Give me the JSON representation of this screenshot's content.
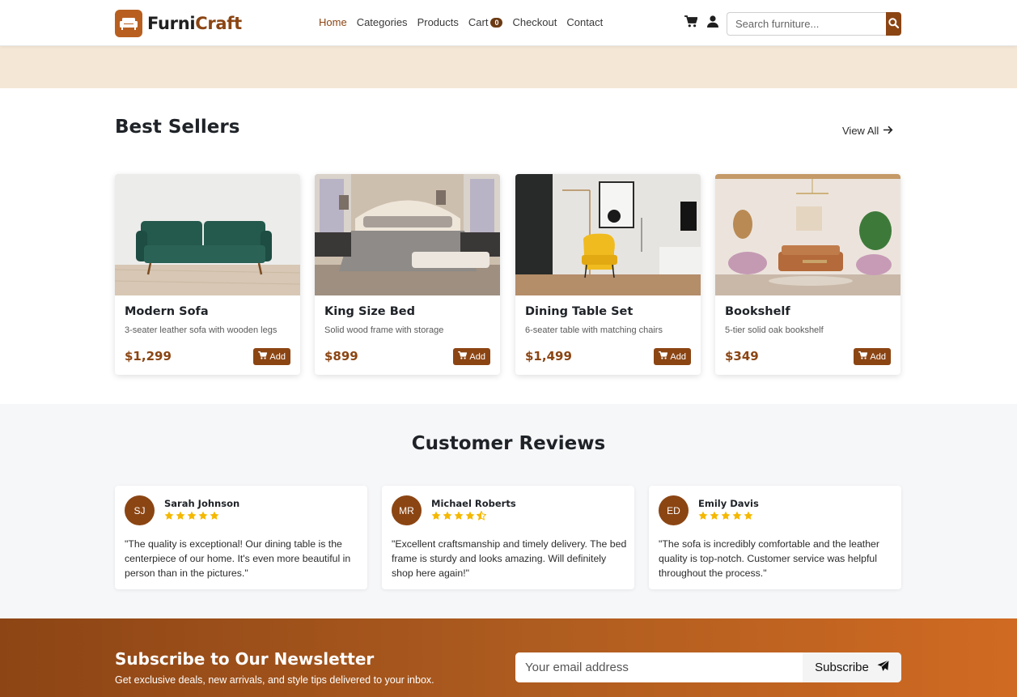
{
  "nav": {
    "brand_part1": "Furni",
    "brand_part2": "Craft",
    "links": [
      "Home",
      "Categories",
      "Products",
      "Cart",
      "Checkout",
      "Contact"
    ],
    "cart_count": "0",
    "search_placeholder": "Search furniture..."
  },
  "best_sellers": {
    "title": "Best Sellers",
    "view_all": "View All",
    "products": [
      {
        "name": "Modern Sofa",
        "desc": "3-seater leather sofa with wooden legs",
        "price": "$1,299",
        "add_label": "Add"
      },
      {
        "name": "King Size Bed",
        "desc": "Solid wood frame with storage",
        "price": "$899",
        "add_label": "Add"
      },
      {
        "name": "Dining Table Set",
        "desc": "6-seater table with matching chairs",
        "price": "$1,499",
        "add_label": "Add"
      },
      {
        "name": "Bookshelf",
        "desc": "5-tier solid oak bookshelf",
        "price": "$349",
        "add_label": "Add"
      }
    ]
  },
  "reviews": {
    "title": "Customer Reviews",
    "items": [
      {
        "initials": "SJ",
        "name": "Sarah Johnson",
        "rating": 5,
        "text": "\"The quality is exceptional! Our dining table is the centerpiece of our home. It's even more beautiful in person than in the pictures.\""
      },
      {
        "initials": "MR",
        "name": "Michael Roberts",
        "rating": 4.5,
        "text": "\"Excellent craftsmanship and timely delivery. The bed frame is sturdy and looks amazing. Will definitely shop here again!\""
      },
      {
        "initials": "ED",
        "name": "Emily Davis",
        "rating": 5,
        "text": "\"The sofa is incredibly comfortable and the leather quality is top-notch. Customer service was helpful throughout the process.\""
      }
    ]
  },
  "newsletter": {
    "title": "Subscribe to Our Newsletter",
    "subtitle": "Get exclusive deals, new arrivals, and style tips delivered to your inbox.",
    "email_placeholder": "Your email address",
    "button_label": "Subscribe"
  },
  "colors": {
    "brand": "#8b4513",
    "star": "#f5b800",
    "hero_strip": "#f5e7d6",
    "reviews_bg": "#f6f7f9"
  },
  "icons": [
    "sofa-logo-icon",
    "cart-icon",
    "user-icon",
    "search-icon",
    "arrow-right-icon",
    "star-icon",
    "half-star-icon",
    "paper-plane-icon"
  ]
}
